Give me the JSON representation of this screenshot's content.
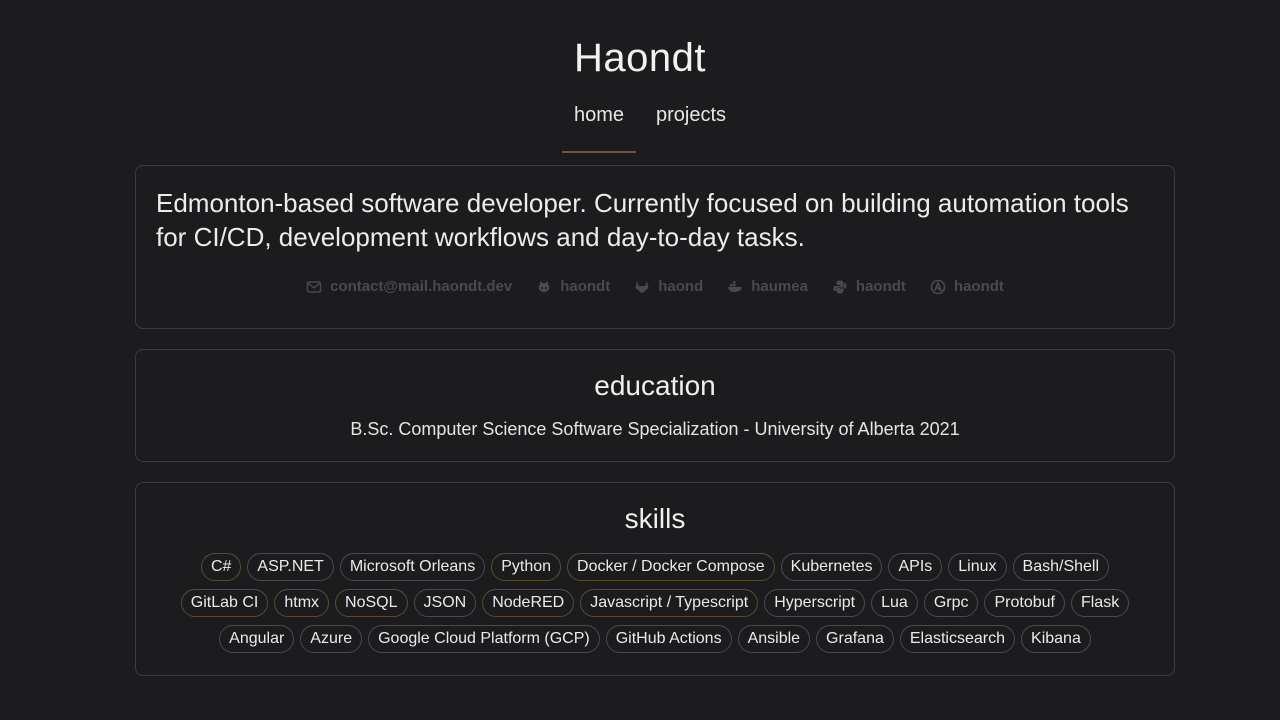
{
  "header": {
    "title": "Haondt"
  },
  "nav": {
    "items": [
      {
        "label": "home",
        "active": true
      },
      {
        "label": "projects",
        "active": false
      }
    ]
  },
  "intro": {
    "text": "Edmonton-based software developer. Currently focused on building automation tools for CI/CD, development workflows and day-to-day tasks.",
    "contacts": [
      {
        "icon": "mail-icon",
        "label": "contact@mail.haondt.dev"
      },
      {
        "icon": "github-icon",
        "label": "haondt"
      },
      {
        "icon": "gitlab-icon",
        "label": "haond"
      },
      {
        "icon": "docker-icon",
        "label": "haumea"
      },
      {
        "icon": "python-icon",
        "label": "haondt"
      },
      {
        "icon": "ansible-icon",
        "label": "haondt"
      }
    ]
  },
  "education": {
    "heading": "education",
    "text": "B.Sc. Computer Science Software Specialization - University of Alberta 2021"
  },
  "skills": {
    "heading": "skills",
    "items": [
      "C#",
      "ASP.NET",
      "Microsoft Orleans",
      "Python",
      "Docker / Docker Compose",
      "Kubernetes",
      "APIs",
      "Linux",
      "Bash/Shell",
      "GitLab CI",
      "htmx",
      "NoSQL",
      "JSON",
      "NodeRED",
      "Javascript / Typescript",
      "Hyperscript",
      "Lua",
      "Grpc",
      "Protobuf",
      "Flask",
      "Angular",
      "Azure",
      "Google Cloud Platform (GCP)",
      "GitHub Actions",
      "Ansible",
      "Grafana",
      "Elasticsearch",
      "Kibana"
    ]
  },
  "colors": {
    "background": "#1c1c1e",
    "accent": "#6b5a3a",
    "muted": "#4a4a4e"
  }
}
